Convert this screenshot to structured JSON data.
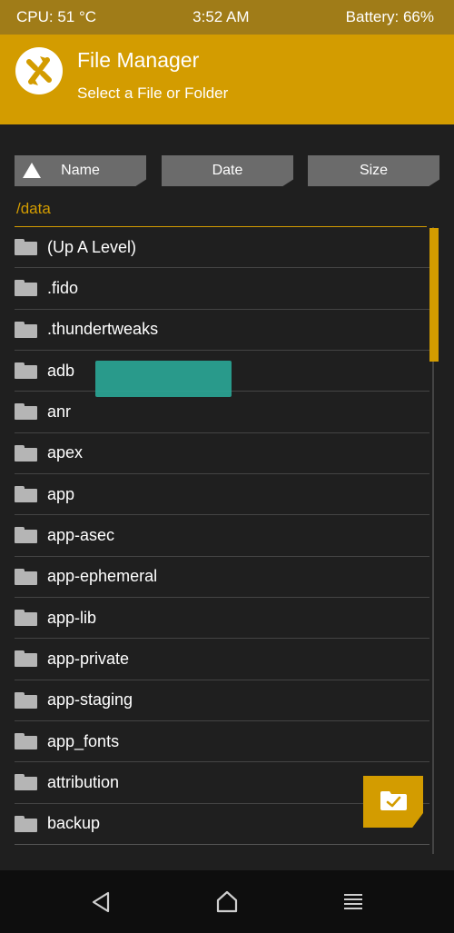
{
  "status": {
    "cpu": "CPU: 51 °C",
    "time": "3:52 AM",
    "battery": "Battery: 66%"
  },
  "header": {
    "title": "File Manager",
    "subtitle": "Select a File or Folder",
    "logo_icon": "twrp-logo-icon"
  },
  "sort": {
    "name": "Name",
    "date": "Date",
    "size": "Size"
  },
  "path": "/data",
  "files": [
    "(Up A Level)",
    ".fido",
    ".thundertweaks",
    "adb",
    "anr",
    "apex",
    "app",
    "app-asec",
    "app-ephemeral",
    "app-lib",
    "app-private",
    "app-staging",
    "app_fonts",
    "attribution",
    "backup"
  ],
  "colors": {
    "accent": "#d39c00",
    "statusbar": "#a07c18",
    "background": "#1f1f1f",
    "redaction": "#2aa797"
  },
  "fab": {
    "icon": "folder-check-icon"
  },
  "nav": {
    "back_icon": "back-triangle-icon",
    "home_icon": "home-icon",
    "menu_icon": "menu-lines-icon"
  }
}
